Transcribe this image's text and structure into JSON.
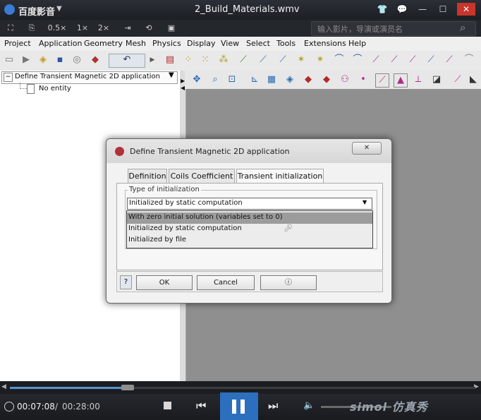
{
  "player": {
    "app_name": "百度影音",
    "file_name": "2_Build_Materials.wmv",
    "window_buttons": [
      "👕",
      "💬",
      "—",
      "☐",
      "✕"
    ],
    "toolbar_buttons": [
      "⛶",
      "⎘",
      "0.5×",
      "1×",
      "2×",
      "⇥",
      "⟲",
      "▣"
    ],
    "search_placeholder": "输入影片，导演或演员名",
    "current_time": "00:07:08",
    "total_time": "00:28:00",
    "time_separator": "/",
    "watermark": "simol 仿真秀"
  },
  "app": {
    "menus": [
      "Project",
      "Application",
      "Geometry",
      "Mesh",
      "Physics",
      "Display",
      "View",
      "Select",
      "Tools",
      "Extensions",
      "Help"
    ],
    "tree_root": "Define Transient Magnetic 2D application",
    "tree_child": "No entity"
  },
  "dialog": {
    "title": "Define Transient Magnetic 2D application",
    "close_label": "✕",
    "tabs": [
      "Definition",
      "Coils Coefficient",
      "Transient initialization"
    ],
    "active_tab": "Transient initialization",
    "group_label": "Type of initialization",
    "selected_value": "Initialized by static computation",
    "options": [
      "With zero initial solution (variables set to 0)",
      "Initialized by static computation",
      "Initialized by file"
    ],
    "highlighted_option": "With zero initial solution (variables set to 0)",
    "ok_label": "OK",
    "cancel_label": "Cancel"
  },
  "colors": {
    "work_area": "#8f8f8f",
    "accent_blue": "#2c6fbe",
    "close_red": "#c9342b"
  }
}
